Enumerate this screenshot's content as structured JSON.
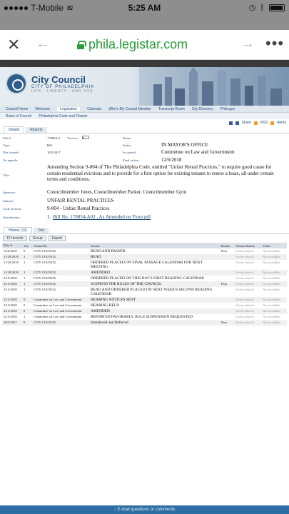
{
  "status_bar": {
    "carrier": "T-Mobile",
    "time": "5:25 AM"
  },
  "browser": {
    "url": "phila.legistar.com"
  },
  "site": {
    "brand_title": "City Council",
    "brand_sub": "CITY OF PHILADELPHIA",
    "brand_motto": "LIFE · LIBERTY · AND YOU"
  },
  "nav_primary": [
    "Council Home",
    "Welcome",
    "Legislation",
    "Calendar",
    "Who's My Council Member",
    "Transcript Room",
    "City Directory",
    "Phila.gov"
  ],
  "nav_secondary": [
    "Rules of Council",
    "Philadelphia Code and Charter"
  ],
  "share_tools": [
    "Share",
    "RSS",
    "Alerts"
  ],
  "tabs": [
    "Details",
    "Reports"
  ],
  "details": {
    "file_label": "File #:",
    "file_value": "170854-A",
    "version_label": "Version:",
    "version_value": "0",
    "name_label": "Name:",
    "type_label": "Type:",
    "type_value": "Bill",
    "status_label": "Status:",
    "status_value": "IN MAYOR'S OFFICE",
    "created_label": "File created:",
    "created_value": "10/5/2017",
    "control_label": "In control:",
    "control_value": "Committee on Law and Government",
    "agenda_label": "On agenda:",
    "final_label": "Final action:",
    "final_value": "12/6/2018",
    "title_label": "Title:",
    "title_value": "Amending Section 9-804 of The Philadelphia Code, entitled \"Unfair Rental Practices,\" to require good cause for certain residential evictions and to provide for a first option for existing tenants to renew a lease, all under certain terms and conditions.",
    "sponsors_label": "Sponsors:",
    "sponsors_value": "Councilmember Jones, Councilmember Parker, Councilmember Gym",
    "indexes_label": "Indexes:",
    "indexes_value": "UNFAIR RENTAL PRACTICES",
    "code_label": "Code sections:",
    "code_value": "9-804 - Unfair Rental Practices",
    "attach_label": "Attachments:",
    "attach_num": "1.",
    "attach_value": "Bill No. 170854-A02 , As Amended on Floor.pdf"
  },
  "history_tabs": [
    "History (12)",
    "Text"
  ],
  "history_toolbar": [
    "12 records",
    "Group",
    "Export"
  ],
  "history_headers": [
    "Date",
    "Ver.",
    "Action By",
    "Action",
    "Result",
    "Action Details",
    "Video"
  ],
  "history_rows": [
    {
      "date": "12/6/2018",
      "ver": "0",
      "by": "CITY COUNCIL",
      "action": "READ AND PASSED",
      "result": "Pass",
      "details": "Action details",
      "video": "Not available"
    },
    {
      "date": "11/29/2018",
      "ver": "1",
      "by": "CITY COUNCIL",
      "action": "READ",
      "result": "",
      "details": "Action details",
      "video": "Not available"
    },
    {
      "date": "11/29/2018",
      "ver": "2",
      "by": "CITY COUNCIL",
      "action": "ORDERED PLACED ON FINAL PASSAGE CALENDAR FOR NEXT MEETING.",
      "result": "",
      "details": "Action details",
      "video": "Not available"
    },
    {
      "date": "11/29/2018",
      "ver": "2",
      "by": "CITY COUNCIL",
      "action": "AMENDED",
      "result": "",
      "details": "Action details",
      "video": "Not available"
    },
    {
      "date": "2/15/2018",
      "ver": "1",
      "by": "CITY COUNCIL",
      "action": "ORDERED PLACED ON THIS DAY'S FIRST READING CALENDAR",
      "result": "",
      "details": "Action details",
      "video": "Not available"
    },
    {
      "date": "2/15/2018",
      "ver": "1",
      "by": "CITY COUNCIL",
      "action": "SUSPEND THE RULES OF THE COUNCIL",
      "result": "Pass",
      "details": "Action details",
      "video": "Not available"
    },
    {
      "date": "2/15/2018",
      "ver": "1",
      "by": "CITY COUNCIL",
      "action": "READ AND ORDERED PLACED ON NEXT WEEK'S SECOND READING CALENDAR",
      "result": "",
      "details": "Action details",
      "video": "Not available"
    },
    {
      "date": "2/13/2018",
      "ver": "0",
      "by": "Committee on Law and Government",
      "action": "HEARING NOTICES SENT",
      "result": "",
      "details": "Action details",
      "video": "Not available"
    },
    {
      "date": "2/13/2018",
      "ver": "0",
      "by": "Committee on Law and Government",
      "action": "HEARING HELD",
      "result": "",
      "details": "Action details",
      "video": "Not available"
    },
    {
      "date": "2/13/2018",
      "ver": "0",
      "by": "Committee on Law and Government",
      "action": "AMENDED",
      "result": "",
      "details": "Action details",
      "video": "Not available"
    },
    {
      "date": "2/13/2018",
      "ver": "1",
      "by": "Committee on Law and Government",
      "action": "REPORTED FAVORABLY, RULE SUSPENSION REQUESTED",
      "result": "",
      "details": "Action details",
      "video": "Not available"
    },
    {
      "date": "10/5/2017",
      "ver": "0",
      "by": "CITY COUNCIL",
      "action": "Introduced and Referred",
      "result": "Pass",
      "details": "Action details",
      "video": "Not available"
    }
  ],
  "footer": {
    "text": ":: E-mail questions or comments"
  }
}
